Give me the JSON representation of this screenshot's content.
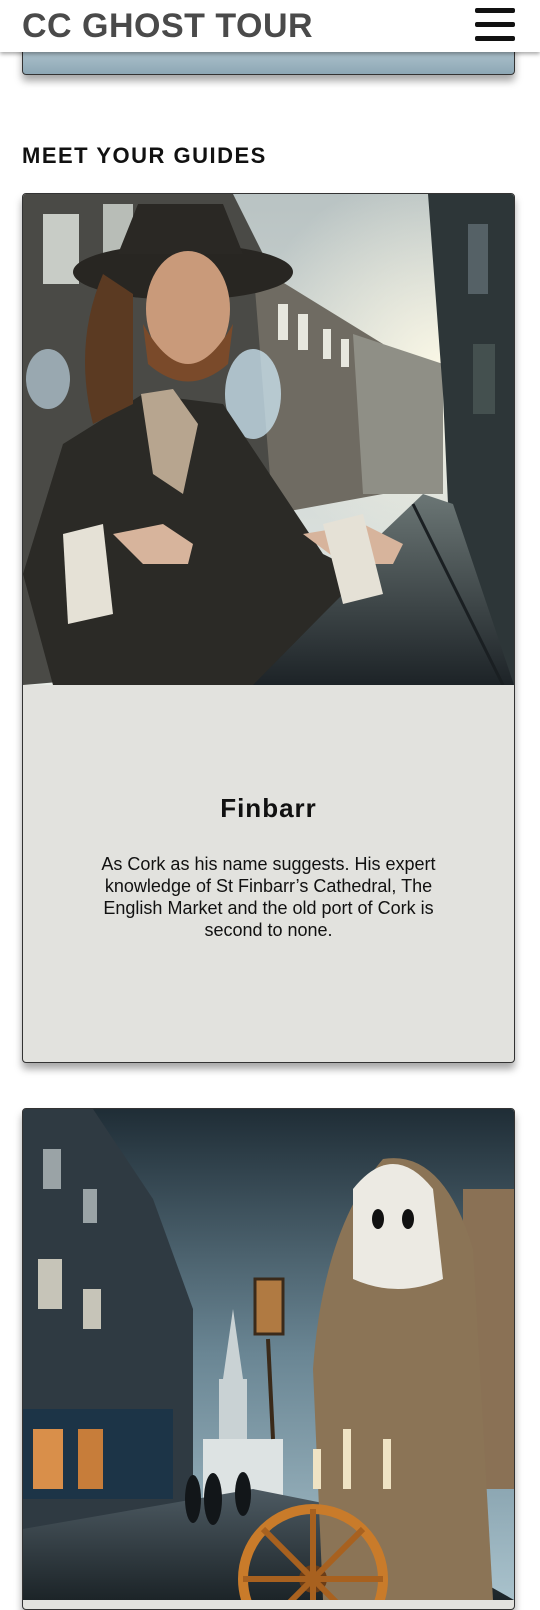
{
  "header": {
    "title": "CC GHOST TOUR",
    "menu_icon": "hamburger-menu-icon"
  },
  "guides_section": {
    "heading": "MEET YOUR GUIDES",
    "guides": [
      {
        "name": "Finbarr",
        "bio": "As Cork as his name suggests. His expert knowledge of St Finbarr’s Cathedral, The English Market and the old port of Cork is second to none.",
        "image": "guide-photo-finbarr"
      },
      {
        "image": "guide-photo-hooded-ghost"
      }
    ]
  },
  "colors": {
    "header_text": "#4a4a4a",
    "card_body_bg": "#e2e2de",
    "text": "#111111"
  }
}
